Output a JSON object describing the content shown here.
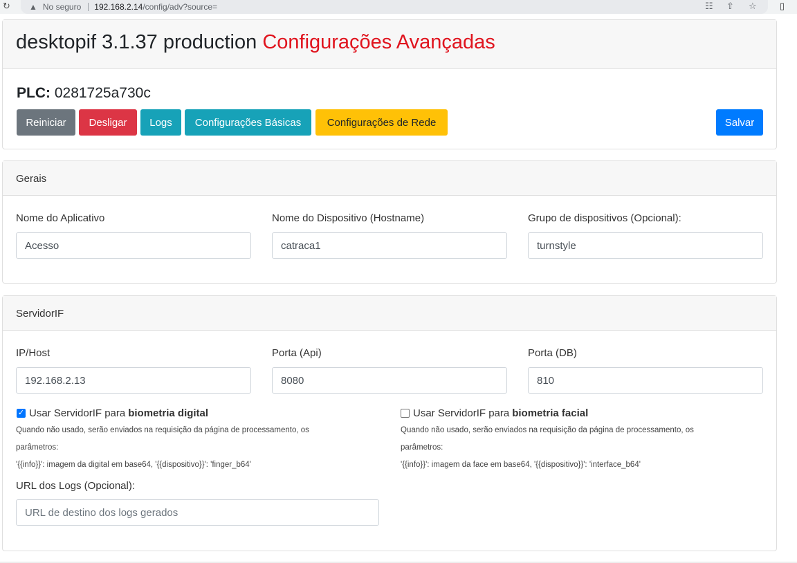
{
  "browser": {
    "insecure_label": "No seguro",
    "url_host": "192.168.2.14",
    "url_path": "/config/adv?source="
  },
  "header": {
    "title_main": "desktopif 3.1.37 production",
    "title_accent": "Configurações Avançadas",
    "plc_label": "PLC:",
    "plc_value": "0281725a730c"
  },
  "toolbar": {
    "reiniciar": "Reiniciar",
    "desligar": "Desligar",
    "logs": "Logs",
    "basicas": "Configurações Básicas",
    "rede": "Configurações de Rede",
    "salvar": "Salvar"
  },
  "gerais": {
    "title": "Gerais",
    "app_name_label": "Nome do Aplicativo",
    "app_name_value": "Acesso",
    "device_name_label": "Nome do Dispositivo (Hostname)",
    "device_name_value": "catraca1",
    "group_label": "Grupo de dispositivos (Opcional):",
    "group_value": "turnstyle"
  },
  "servidor": {
    "title": "ServidorIF",
    "ip_label": "IP/Host",
    "ip_value": "192.168.2.13",
    "api_port_label": "Porta (Api)",
    "api_port_value": "8080",
    "db_port_label": "Porta (DB)",
    "db_port_value": "810",
    "digital": {
      "checked": true,
      "label_prefix": "Usar ServidorIF para",
      "label_bold": "biometria digital",
      "help_1": "Quando não usado, serão enviados na requisição da página de processamento, os",
      "help_2": "parâmetros:",
      "help_3": "'{{info}}': imagem da digital em base64, '{{dispositivo}}': 'finger_b64'"
    },
    "facial": {
      "checked": false,
      "label_prefix": "Usar ServidorIF para",
      "label_bold": "biometria facial",
      "help_1": "Quando não usado, serão enviados na requisição da página de processamento, os",
      "help_2": "parâmetros:",
      "help_3": "'{{info}}': imagem da face em base64, '{{dispositivo}}': 'interface_b64'"
    },
    "logs_url_label": "URL dos Logs (Opcional):",
    "logs_url_placeholder": "URL de destino dos logs gerados"
  },
  "colors": {
    "accent_title": "#e0141e",
    "btn_secondary": "#6c757d",
    "btn_danger": "#dc3545",
    "btn_info": "#17a2b8",
    "btn_warning": "#ffc107",
    "btn_primary": "#007bff"
  }
}
